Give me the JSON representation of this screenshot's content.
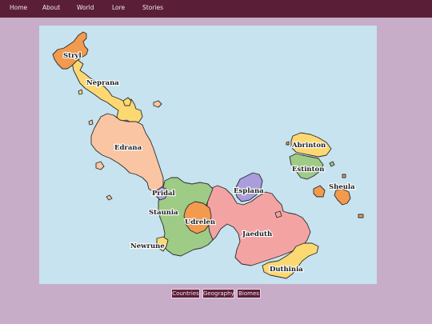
{
  "nav": {
    "items": [
      {
        "label": "Home"
      },
      {
        "label": "About"
      },
      {
        "label": "World"
      },
      {
        "label": "Lore"
      },
      {
        "label": "Stories"
      }
    ]
  },
  "map": {
    "regions": [
      {
        "name": "Stryl",
        "color": "#f29a4e"
      },
      {
        "name": "Neprana",
        "color": "#fcd873"
      },
      {
        "name": "Edrana",
        "color": "#f9c5a2"
      },
      {
        "name": "Pridal",
        "color": "#a99ddb"
      },
      {
        "name": "Staunia",
        "color": "#9ecb86"
      },
      {
        "name": "Udrelen",
        "color": "#f29a4e"
      },
      {
        "name": "Newrune",
        "color": "#fcd873"
      },
      {
        "name": "Esplana",
        "color": "#a99ddb"
      },
      {
        "name": "Jaeduth",
        "color": "#f4a3a3"
      },
      {
        "name": "Duthinia",
        "color": "#fcd873"
      },
      {
        "name": "Abrinton",
        "color": "#fcd873"
      },
      {
        "name": "Estinton",
        "color": "#9ecb86"
      },
      {
        "name": "Sheula",
        "color": "#f29a4e"
      }
    ],
    "ocean_color": "#c6e3ef"
  },
  "tabs": [
    {
      "label": "Countries"
    },
    {
      "label": "Geography"
    },
    {
      "label": "Biomes"
    }
  ],
  "colors": {
    "nav_bg": "#5a1f36",
    "page_bg": "#c8adc9"
  }
}
